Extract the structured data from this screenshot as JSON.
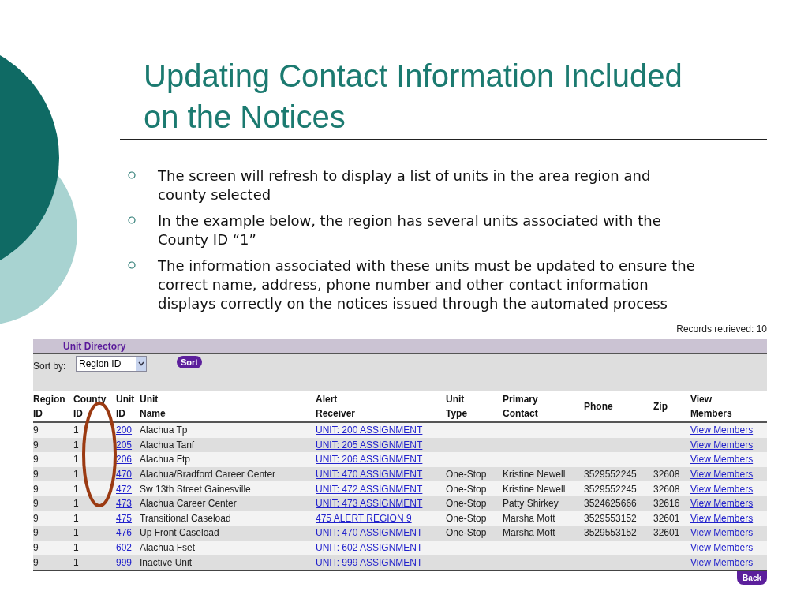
{
  "slide": {
    "title": "Updating Contact Information Included on the Notices",
    "bullets": [
      "The screen will refresh to display a list of units in the area region and county selected",
      "In the example below, the region has several units associated with the County ID “1”",
      "The information associated with these units must be updated to ensure the correct name, address, phone number and other contact information displays correctly on the notices issued through the automated process"
    ]
  },
  "unit_directory": {
    "records_retrieved": "Records retrieved: 10",
    "heading": "Unit Directory",
    "sort_label": "Sort by:",
    "sort_value": "Region ID",
    "sort_button": "Sort",
    "columns": [
      "Region ID",
      "County ID",
      "Unit ID",
      "Unit Name",
      "Alert Receiver",
      "Unit Type",
      "Primary Contact",
      "Phone",
      "Zip",
      "View Members"
    ],
    "rows": [
      {
        "region_id": "9",
        "county_id": "1",
        "unit_id": "200",
        "unit_name": "Alachua Tp",
        "alert_receiver": "UNIT: 200 ASSIGNMENT",
        "unit_type": "",
        "primary_contact": "",
        "phone": "",
        "zip": "",
        "view": "View Members"
      },
      {
        "region_id": "9",
        "county_id": "1",
        "unit_id": "205",
        "unit_name": "Alachua Tanf",
        "alert_receiver": "UNIT: 205 ASSIGNMENT",
        "unit_type": "",
        "primary_contact": "",
        "phone": "",
        "zip": "",
        "view": "View Members"
      },
      {
        "region_id": "9",
        "county_id": "1",
        "unit_id": "206",
        "unit_name": "Alachua Ftp",
        "alert_receiver": "UNIT: 206 ASSIGNMENT",
        "unit_type": "",
        "primary_contact": "",
        "phone": "",
        "zip": "",
        "view": "View Members"
      },
      {
        "region_id": "9",
        "county_id": "1",
        "unit_id": "470",
        "unit_name": "Alachua/Bradford Career Center",
        "alert_receiver": "UNIT: 470 ASSIGNMENT",
        "unit_type": "One-Stop",
        "primary_contact": "Kristine Newell",
        "phone": "3529552245",
        "zip": "32608",
        "view": "View Members"
      },
      {
        "region_id": "9",
        "county_id": "1",
        "unit_id": "472",
        "unit_name": "Sw 13th Street Gainesville",
        "alert_receiver": "UNIT: 472 ASSIGNMENT",
        "unit_type": "One-Stop",
        "primary_contact": "Kristine Newell",
        "phone": "3529552245",
        "zip": "32608",
        "view": "View Members"
      },
      {
        "region_id": "9",
        "county_id": "1",
        "unit_id": "473",
        "unit_name": "Alachua Career Center",
        "alert_receiver": "UNIT: 473 ASSIGNMENT",
        "unit_type": "One-Stop",
        "primary_contact": "Patty Shirkey",
        "phone": "3524625666",
        "zip": "32616",
        "view": "View Members"
      },
      {
        "region_id": "9",
        "county_id": "1",
        "unit_id": "475",
        "unit_name": "Transitional Caseload",
        "alert_receiver": "475 ALERT REGION 9",
        "unit_type": "One-Stop",
        "primary_contact": "Marsha Mott",
        "phone": "3529553152",
        "zip": "32601",
        "view": "View Members"
      },
      {
        "region_id": "9",
        "county_id": "1",
        "unit_id": "476",
        "unit_name": "Up Front Caseload",
        "alert_receiver": "UNIT: 470 ASSIGNMENT",
        "unit_type": "One-Stop",
        "primary_contact": "Marsha Mott",
        "phone": "3529553152",
        "zip": "32601",
        "view": "View Members"
      },
      {
        "region_id": "9",
        "county_id": "1",
        "unit_id": "602",
        "unit_name": "Alachua Fset",
        "alert_receiver": "UNIT: 602 ASSIGNMENT",
        "unit_type": "",
        "primary_contact": "",
        "phone": "",
        "zip": "",
        "view": "View Members"
      },
      {
        "region_id": "9",
        "county_id": "1",
        "unit_id": "999",
        "unit_name": "Inactive Unit",
        "alert_receiver": "UNIT: 999 ASSIGNMENT",
        "unit_type": "",
        "primary_contact": "",
        "phone": "",
        "zip": "",
        "view": "View Members"
      }
    ],
    "back_button": "Back"
  }
}
